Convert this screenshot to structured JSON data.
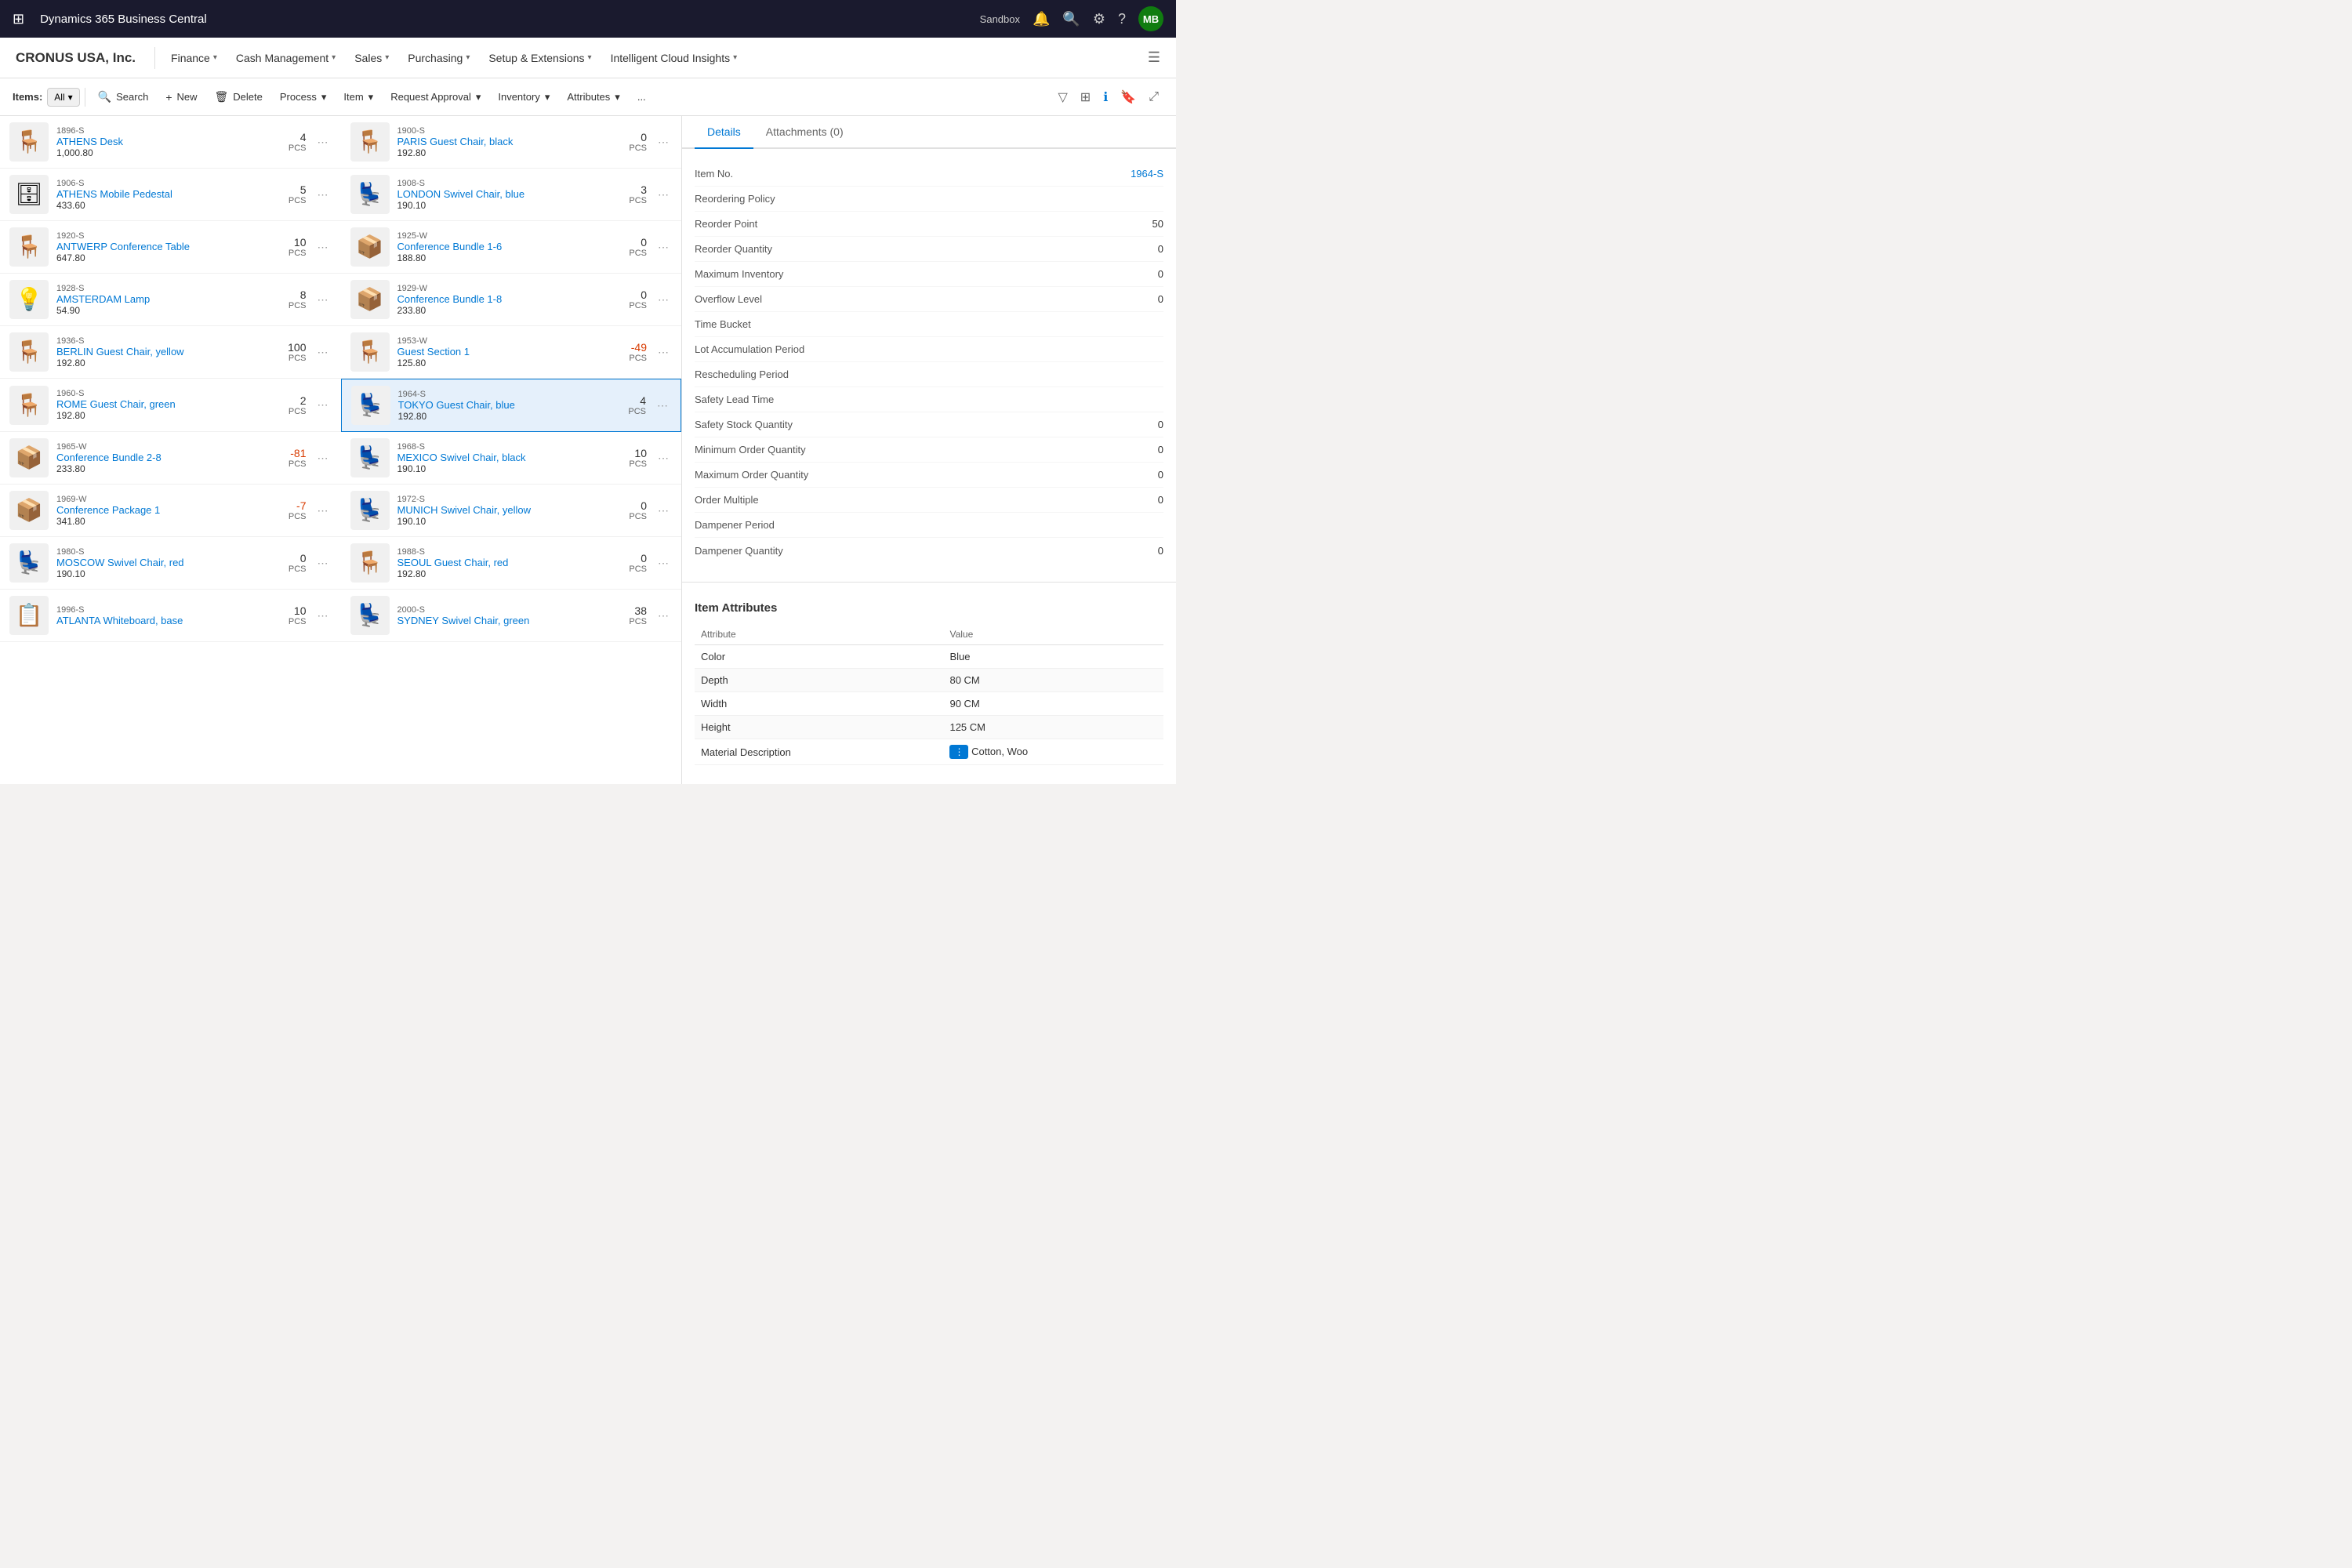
{
  "app": {
    "title": "Dynamics 365 Business Central",
    "environment": "Sandbox",
    "user_initials": "MB"
  },
  "menu": {
    "company": "CRONUS USA, Inc.",
    "items": [
      {
        "label": "Finance",
        "arrow": true
      },
      {
        "label": "Cash Management",
        "arrow": true
      },
      {
        "label": "Sales",
        "arrow": true
      },
      {
        "label": "Purchasing",
        "arrow": true
      },
      {
        "label": "Setup & Extensions",
        "arrow": true
      },
      {
        "label": "Intelligent Cloud Insights",
        "arrow": true
      }
    ]
  },
  "toolbar": {
    "label": "Items:",
    "filter": "All",
    "buttons": [
      {
        "label": "Search",
        "icon": "🔍"
      },
      {
        "label": "New",
        "icon": "+"
      },
      {
        "label": "Delete",
        "icon": "🗑"
      },
      {
        "label": "Process",
        "icon": "",
        "dropdown": true
      },
      {
        "label": "Item",
        "icon": "",
        "dropdown": true
      },
      {
        "label": "Request Approval",
        "icon": "",
        "dropdown": true
      },
      {
        "label": "Inventory",
        "icon": "",
        "dropdown": true
      },
      {
        "label": "Attributes",
        "icon": "",
        "dropdown": true
      },
      {
        "label": "...",
        "icon": ""
      }
    ]
  },
  "items": [
    {
      "code": "1896-S",
      "name": "ATHENS Desk",
      "price": "1,000.80",
      "qty": 4,
      "unit": "PCS",
      "emoji": "🪑"
    },
    {
      "code": "1900-S",
      "name": "PARIS Guest Chair, black",
      "price": "192.80",
      "qty": 0,
      "unit": "PCS",
      "emoji": "🪑"
    },
    {
      "code": "1906-S",
      "name": "ATHENS Mobile Pedestal",
      "price": "433.60",
      "qty": 5,
      "unit": "PCS",
      "emoji": "🗄"
    },
    {
      "code": "1908-S",
      "name": "LONDON Swivel Chair, blue",
      "price": "190.10",
      "qty": 3,
      "unit": "PCS",
      "emoji": "💺"
    },
    {
      "code": "1920-S",
      "name": "ANTWERP Conference Table",
      "price": "647.80",
      "qty": 10,
      "unit": "PCS",
      "emoji": "🪑"
    },
    {
      "code": "1925-W",
      "name": "Conference Bundle 1-6",
      "price": "188.80",
      "qty": 0,
      "unit": "PCS",
      "emoji": "📦"
    },
    {
      "code": "1928-S",
      "name": "AMSTERDAM Lamp",
      "price": "54.90",
      "qty": 8,
      "unit": "PCS",
      "emoji": "💡"
    },
    {
      "code": "1929-W",
      "name": "Conference Bundle 1-8",
      "price": "233.80",
      "qty": 0,
      "unit": "PCS",
      "emoji": "📦"
    },
    {
      "code": "1936-S",
      "name": "BERLIN Guest Chair, yellow",
      "price": "192.80",
      "qty": 100,
      "unit": "PCS",
      "emoji": "🪑"
    },
    {
      "code": "1953-W",
      "name": "Guest Section 1",
      "price": "125.80",
      "qty": -49,
      "unit": "PCS",
      "emoji": "🪑"
    },
    {
      "code": "1960-S",
      "name": "ROME Guest Chair, green",
      "price": "192.80",
      "qty": 2,
      "unit": "PCS",
      "emoji": "🪑"
    },
    {
      "code": "1964-S",
      "name": "TOKYO Guest Chair, blue",
      "price": "192.80",
      "qty": 4,
      "unit": "PCS",
      "emoji": "💺",
      "selected": true
    },
    {
      "code": "1965-W",
      "name": "Conference Bundle 2-8",
      "price": "233.80",
      "qty": -81,
      "unit": "PCS",
      "emoji": "📦"
    },
    {
      "code": "1968-S",
      "name": "MEXICO Swivel Chair, black",
      "price": "190.10",
      "qty": 10,
      "unit": "PCS",
      "emoji": "💺"
    },
    {
      "code": "1969-W",
      "name": "Conference Package 1",
      "price": "341.80",
      "qty": -7,
      "unit": "PCS",
      "emoji": "📦"
    },
    {
      "code": "1972-S",
      "name": "MUNICH Swivel Chair, yellow",
      "price": "190.10",
      "qty": 0,
      "unit": "PCS",
      "emoji": "💺"
    },
    {
      "code": "1980-S",
      "name": "MOSCOW Swivel Chair, red",
      "price": "190.10",
      "qty": 0,
      "unit": "PCS",
      "emoji": "💺"
    },
    {
      "code": "1988-S",
      "name": "SEOUL Guest Chair, red",
      "price": "192.80",
      "qty": 0,
      "unit": "PCS",
      "emoji": "🪑"
    },
    {
      "code": "1996-S",
      "name": "ATLANTA Whiteboard, base",
      "price": "",
      "qty": 10,
      "unit": "PCS",
      "emoji": "📋"
    },
    {
      "code": "2000-S",
      "name": "SYDNEY Swivel Chair, green",
      "price": "",
      "qty": 38,
      "unit": "PCS",
      "emoji": "💺"
    }
  ],
  "detail": {
    "tabs": [
      {
        "label": "Details",
        "active": true
      },
      {
        "label": "Attachments (0)",
        "active": false
      }
    ],
    "item_no": "1964-S",
    "fields": [
      {
        "label": "Item No.",
        "value": "1964-S",
        "link": true
      },
      {
        "label": "Reordering Policy",
        "value": ""
      },
      {
        "label": "Reorder Point",
        "value": "50"
      },
      {
        "label": "Reorder Quantity",
        "value": "0"
      },
      {
        "label": "Maximum Inventory",
        "value": "0"
      },
      {
        "label": "Overflow Level",
        "value": "0"
      },
      {
        "label": "Time Bucket",
        "value": ""
      },
      {
        "label": "Lot Accumulation Period",
        "value": ""
      },
      {
        "label": "Rescheduling Period",
        "value": ""
      },
      {
        "label": "Safety Lead Time",
        "value": ""
      },
      {
        "label": "Safety Stock Quantity",
        "value": "0"
      },
      {
        "label": "Minimum Order Quantity",
        "value": "0"
      },
      {
        "label": "Maximum Order Quantity",
        "value": "0"
      },
      {
        "label": "Order Multiple",
        "value": "0"
      },
      {
        "label": "Dampener Period",
        "value": ""
      },
      {
        "label": "Dampener Quantity",
        "value": "0"
      }
    ],
    "attributes_title": "Item Attributes",
    "attributes_headers": [
      "Attribute",
      "Value"
    ],
    "attributes": [
      {
        "attr": "Color",
        "value": "Blue"
      },
      {
        "attr": "Depth",
        "value": "80 CM"
      },
      {
        "attr": "Width",
        "value": "90 CM"
      },
      {
        "attr": "Height",
        "value": "125 CM"
      },
      {
        "attr": "Material Description",
        "value": "Cotton, Woo"
      }
    ]
  }
}
